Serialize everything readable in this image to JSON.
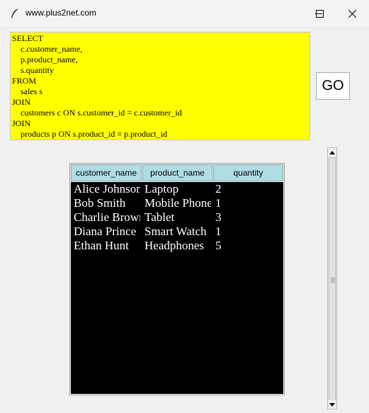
{
  "window": {
    "title": "www.plus2net.com",
    "app_icon": "feather-icon",
    "controls": [
      "minimize-icon",
      "maximize-icon",
      "close-icon"
    ]
  },
  "query": {
    "lines": [
      "SELECT",
      "    c.customer_name,",
      "    p.product_name,",
      "    s.quantity",
      "FROM",
      "    sales s",
      "JOIN",
      "    customers c ON s.customer_id = c.customer_id",
      "JOIN",
      "    products p ON s.product_id = p.product_id"
    ],
    "background": "#ffff00"
  },
  "go_button": {
    "label": "GO"
  },
  "table": {
    "header_color": "#b0dde4",
    "columns": [
      "customer_name",
      "product_name",
      "quantity"
    ],
    "rows": [
      [
        "Alice Johnson",
        "Laptop",
        "2"
      ],
      [
        "Bob Smith",
        "Mobile Phone",
        "1"
      ],
      [
        "Charlie Brown",
        "Tablet",
        "3"
      ],
      [
        "Diana Prince",
        "Smart Watch",
        "1"
      ],
      [
        "Ethan Hunt",
        "Headphones",
        "5"
      ]
    ]
  }
}
